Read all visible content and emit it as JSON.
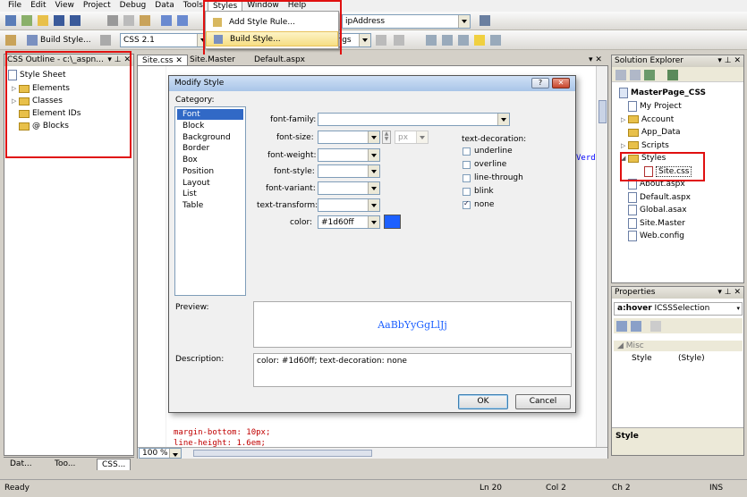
{
  "menubar": [
    "File",
    "Edit",
    "View",
    "Project",
    "Debug",
    "Data",
    "Tools",
    "Styles",
    "Window",
    "Help"
  ],
  "styles_menu": {
    "active": "Styles",
    "items": [
      {
        "label": "Add Style Rule...",
        "icon": "add-style-rule-icon"
      },
      {
        "label": "Build Style...",
        "icon": "build-style-icon",
        "highlighted": true
      }
    ]
  },
  "toolbar1": {
    "address_combo": "ipAddress"
  },
  "toolbar2": {
    "build_style": "Build Style...",
    "css_version": "CSS 2.1",
    "right_combo": "ings"
  },
  "css_outline": {
    "title": "CSS Outline - c:\\_aspn...",
    "root": "Style Sheet",
    "items": [
      "Elements",
      "Classes",
      "Element IDs",
      "@ Blocks"
    ],
    "bottom_tabs": [
      "Dat...",
      "Too...",
      "CSS..."
    ]
  },
  "editor": {
    "tabs": [
      "Site.css",
      "Site.Master",
      "Default.aspx"
    ],
    "active_tab": "Site.css",
    "zoom": "100 %",
    "code_lines": [
      "margin-bottom: 10px;",
      "line-height: 1.6em;"
    ],
    "side_text": "Verd"
  },
  "dialog": {
    "title": "Modify Style",
    "help": "?",
    "category_label": "Category:",
    "categories": [
      "Font",
      "Block",
      "Background",
      "Border",
      "Box",
      "Position",
      "Layout",
      "List",
      "Table"
    ],
    "selected_category": "Font",
    "fields": {
      "font_family": {
        "label": "font-family:",
        "value": ""
      },
      "font_size": {
        "label": "font-size:",
        "value": "",
        "unit": "px"
      },
      "font_weight": {
        "label": "font-weight:",
        "value": ""
      },
      "font_style": {
        "label": "font-style:",
        "value": ""
      },
      "font_variant": {
        "label": "font-variant:",
        "value": ""
      },
      "text_transform": {
        "label": "text-transform:",
        "value": ""
      },
      "color": {
        "label": "color:",
        "value": "#1d60ff",
        "swatch": "#1d60ff"
      }
    },
    "text_decoration": {
      "label": "text-decoration:",
      "options": [
        {
          "label": "underline",
          "checked": false
        },
        {
          "label": "overline",
          "checked": false
        },
        {
          "label": "line-through",
          "checked": false
        },
        {
          "label": "blink",
          "checked": false
        },
        {
          "label": "none",
          "checked": true
        }
      ]
    },
    "preview_label": "Preview:",
    "preview_text": "AaBbYyGgLlJj",
    "description_label": "Description:",
    "description": "color: #1d60ff; text-decoration: none",
    "ok": "OK",
    "cancel": "Cancel"
  },
  "solution_explorer": {
    "title": "Solution Explorer",
    "project": "MasterPage_CSS",
    "items": [
      {
        "label": "My Project",
        "type": "file",
        "level": 1
      },
      {
        "label": "Account",
        "type": "folder",
        "level": 1,
        "expander": "▷"
      },
      {
        "label": "App_Data",
        "type": "folder",
        "level": 1
      },
      {
        "label": "Scripts",
        "type": "folder",
        "level": 1,
        "expander": "▷"
      },
      {
        "label": "Styles",
        "type": "folder",
        "level": 1,
        "expander": "◢"
      },
      {
        "label": "Site.css",
        "type": "css",
        "level": 2,
        "selected": true
      },
      {
        "label": "About.aspx",
        "type": "file",
        "level": 1
      },
      {
        "label": "Default.aspx",
        "type": "file",
        "level": 1
      },
      {
        "label": "Global.asax",
        "type": "file",
        "level": 1
      },
      {
        "label": "Site.Master",
        "type": "file",
        "level": 1
      },
      {
        "label": "Web.config",
        "type": "file",
        "level": 1
      }
    ]
  },
  "properties": {
    "title": "Properties",
    "object": "a:hover",
    "object_type": "ICSSSelection",
    "category": "Misc",
    "rows": [
      {
        "name": "Style",
        "value": "(Style)"
      }
    ],
    "footer_title": "Style"
  },
  "statusbar": {
    "ready": "Ready",
    "ln": "Ln 20",
    "col": "Col 2",
    "ch": "Ch 2",
    "ins": "INS"
  },
  "colors": {
    "accent_red": "#e01010",
    "swatch": "#1d60ff",
    "selection": "#3169c6"
  }
}
